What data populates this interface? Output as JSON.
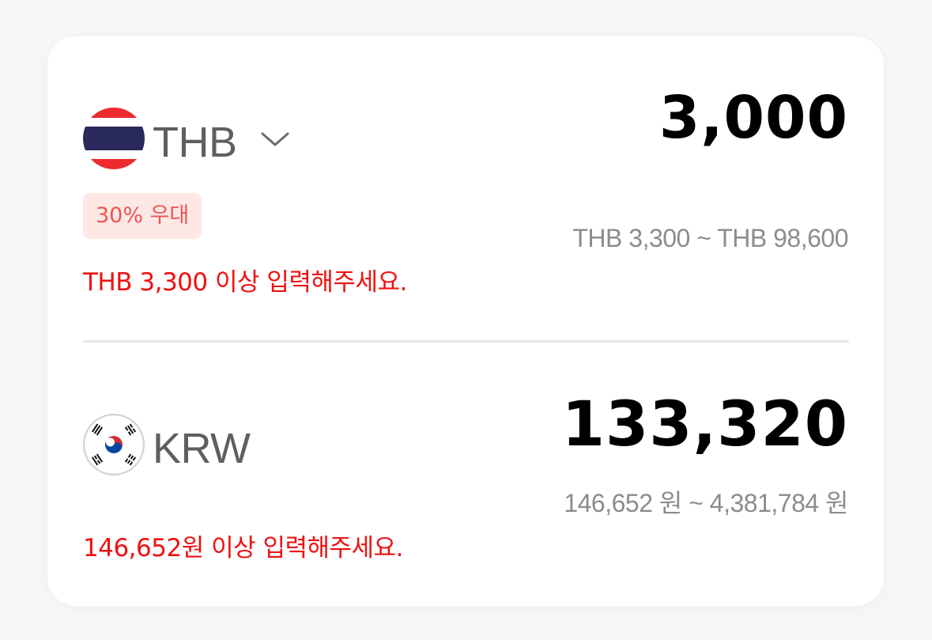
{
  "source": {
    "flag_icon": "thailand-flag-icon",
    "currency_code": "THB",
    "dropdown_icon": "chevron-down-icon",
    "amount": "3,000",
    "discount_badge": "30% 우대",
    "range": "THB 3,300 ~ THB 98,600",
    "error_message": "THB 3,300 이상 입력해주세요."
  },
  "target": {
    "flag_icon": "south-korea-flag-icon",
    "currency_code": "KRW",
    "amount": "133,320",
    "range": "146,652 원 ~ 4,381,784 원",
    "error_message": "146,652원 이상 입력해주세요."
  },
  "colors": {
    "error": "#ee1111",
    "badge_background": "#fde8e6",
    "badge_text": "#f0544f",
    "range_text": "#8c8c8c",
    "currency_code_text": "#5f5f5f",
    "amount_text": "#000000",
    "page_background": "#f6f6f6",
    "card_background": "#ffffff"
  }
}
